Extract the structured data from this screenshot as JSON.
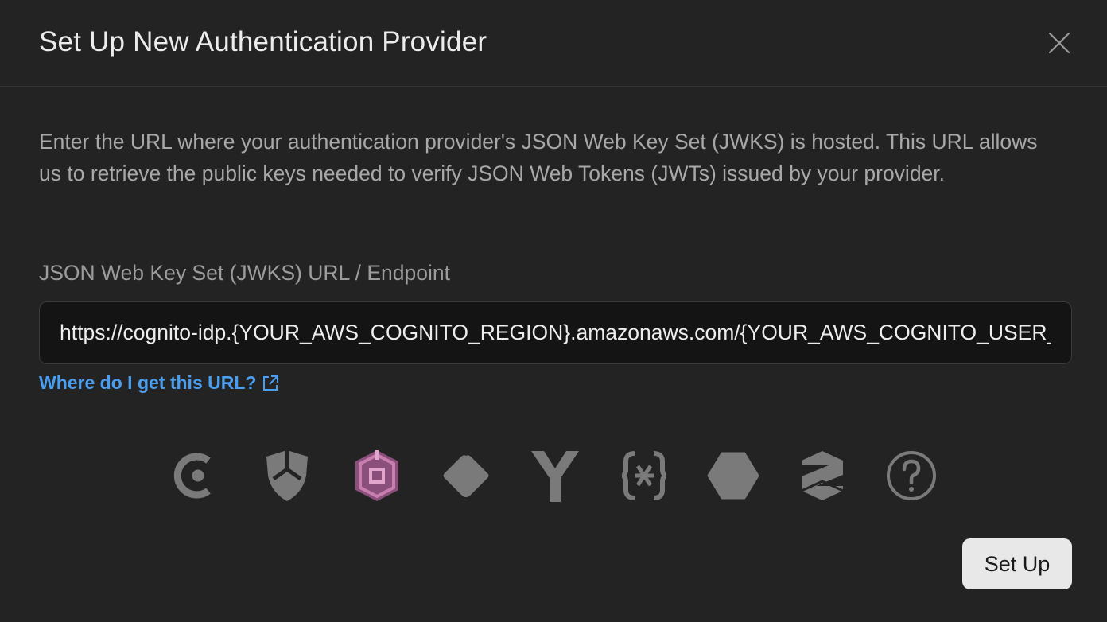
{
  "dialog": {
    "title": "Set Up New Authentication Provider",
    "close_icon": "close-icon",
    "description": "Enter the URL where your authentication provider's JSON Web Key Set (JWKS) is hosted. This URL allows us to retrieve the public keys needed to verify JSON Web Tokens (JWTs) issued by your provider."
  },
  "jwks_field": {
    "label": "JSON Web Key Set (JWKS) URL / Endpoint",
    "value": "https://cognito-idp.{YOUR_AWS_COGNITO_REGION}.amazonaws.com/{YOUR_AWS_COGNITO_USER_POOL_ID}/.well-known/jwks.json"
  },
  "help_link": {
    "label": "Where do I get this URL?",
    "icon": "external-link-icon",
    "color": "#4a9ef0"
  },
  "providers": [
    {
      "name": "clerk",
      "icon": "clerk-icon",
      "selected": false
    },
    {
      "name": "auth0",
      "icon": "auth0-icon",
      "selected": false
    },
    {
      "name": "aws-cognito",
      "icon": "aws-cognito-icon",
      "selected": true
    },
    {
      "name": "diamond-provider",
      "icon": "diamond-provider-icon",
      "selected": false
    },
    {
      "name": "y-provider",
      "icon": "y-provider-icon",
      "selected": false
    },
    {
      "name": "bracket-provider",
      "icon": "bracket-provider-icon",
      "selected": false
    },
    {
      "name": "hexagon-provider",
      "icon": "hexagon-provider-icon",
      "selected": false
    },
    {
      "name": "stack-provider",
      "icon": "stack-provider-icon",
      "selected": false
    },
    {
      "name": "other",
      "icon": "question-mark-icon",
      "selected": false
    }
  ],
  "colors": {
    "background": "#232323",
    "icon_inactive": "#7a7a7a",
    "icon_selected": "#c87fb0",
    "button_bg": "#e8e8e8"
  },
  "submit_button": {
    "label": "Set Up"
  }
}
